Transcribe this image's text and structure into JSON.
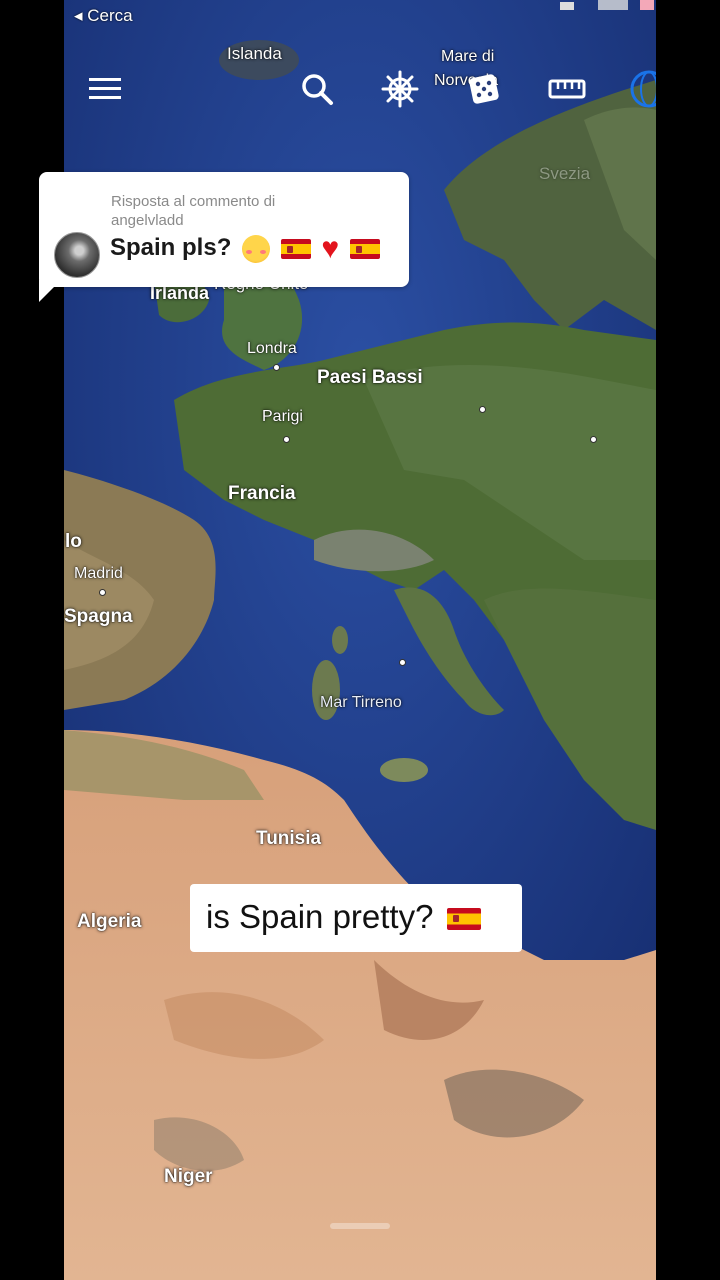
{
  "status_bar": {
    "back_label": "◂ Cerca"
  },
  "toolbar": {
    "menu_icon": "hamburger-menu-icon",
    "search_icon": "search-icon",
    "voyager_icon": "ship-wheel-icon",
    "random_icon": "dice-icon",
    "measure_icon": "ruler-icon",
    "projects_icon": "globe-icon"
  },
  "map": {
    "labels": {
      "islanda": "Islanda",
      "mare_di": "Mare di",
      "norvegia": "Norvegia",
      "svezia": "Svezia",
      "irlanda": "Irlanda",
      "regno_unito": "Regno Unito",
      "londra": "Londra",
      "paesi_bassi": "Paesi Bassi",
      "parigi": "Parigi",
      "francia": "Francia",
      "lo": "lo",
      "madrid": "Madrid",
      "spagna": "Spagna",
      "mar_tirreno": "Mar Tirreno",
      "tunisia": "Tunisia",
      "algeria": "Algeria",
      "niger": "Niger"
    },
    "colors": {
      "ocean": "#1f3d8a",
      "land_green": "#4f6f3a",
      "desert": "#d9a57a"
    }
  },
  "reply": {
    "header": "Risposta al commento di angelvladd",
    "text": "Spain pls?"
  },
  "caption": {
    "text": "is Spain pretty?"
  },
  "fabs": {
    "directions_icon": "navigation-arrow-icon",
    "streetview_icon": "pegman-icon",
    "compass_icon": "compass-icon"
  }
}
